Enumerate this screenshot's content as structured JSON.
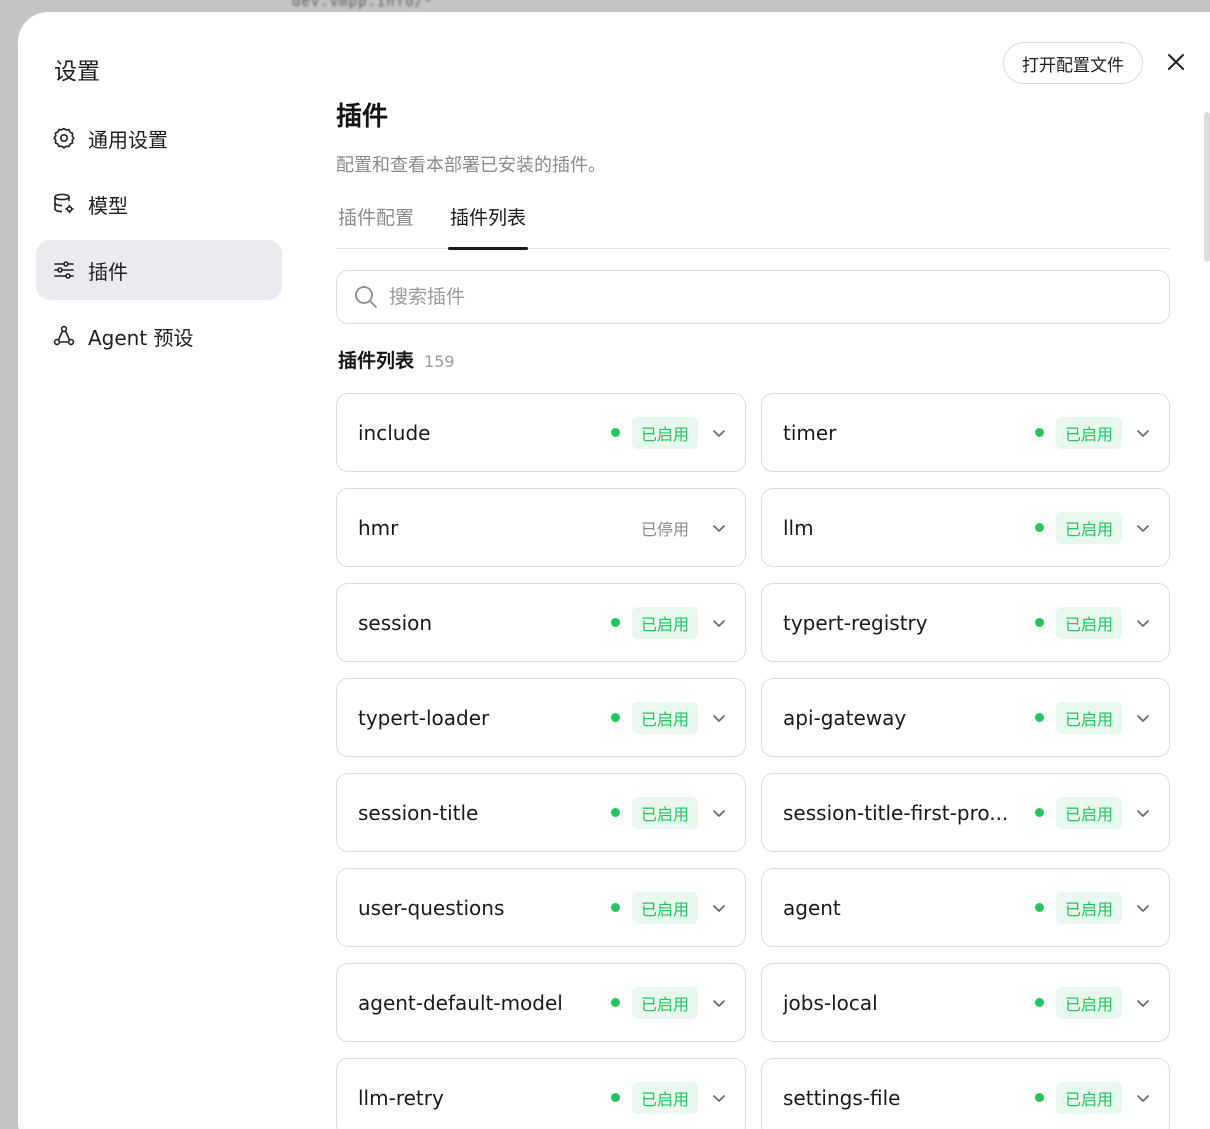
{
  "backdrop": {
    "code_text": "dev.vmpp.info/*"
  },
  "sidebar": {
    "title": "设置",
    "items": [
      {
        "label": "通用设置",
        "icon": "gear-icon",
        "active": false
      },
      {
        "label": "模型",
        "icon": "database-settings-icon",
        "active": false
      },
      {
        "label": "插件",
        "icon": "sliders-icon",
        "active": true
      },
      {
        "label": "Agent 预设",
        "icon": "agent-network-icon",
        "active": false
      }
    ]
  },
  "header": {
    "open_config_label": "打开配置文件",
    "close_icon": "close-icon"
  },
  "main": {
    "title": "插件",
    "description": "配置和查看本部署已安装的插件。",
    "tabs": [
      {
        "label": "插件配置",
        "active": false
      },
      {
        "label": "插件列表",
        "active": true
      }
    ],
    "search": {
      "placeholder": "搜索插件",
      "value": ""
    },
    "list_title": "插件列表",
    "list_count": "159"
  },
  "colors": {
    "enabled": "#22c55e",
    "enabled_bg": "#e8f8ee",
    "active_nav_bg": "#e9ebf0"
  },
  "plugins": [
    {
      "name": "include",
      "status": "已启用",
      "enabled": true
    },
    {
      "name": "timer",
      "status": "已启用",
      "enabled": true
    },
    {
      "name": "hmr",
      "status": "已停用",
      "enabled": false
    },
    {
      "name": "llm",
      "status": "已启用",
      "enabled": true
    },
    {
      "name": "session",
      "status": "已启用",
      "enabled": true
    },
    {
      "name": "typert-registry",
      "status": "已启用",
      "enabled": true
    },
    {
      "name": "typert-loader",
      "status": "已启用",
      "enabled": true
    },
    {
      "name": "api-gateway",
      "status": "已启用",
      "enabled": true
    },
    {
      "name": "session-title",
      "status": "已启用",
      "enabled": true
    },
    {
      "name": "session-title-first-pro...",
      "status": "已启用",
      "enabled": true
    },
    {
      "name": "user-questions",
      "status": "已启用",
      "enabled": true
    },
    {
      "name": "agent",
      "status": "已启用",
      "enabled": true
    },
    {
      "name": "agent-default-model",
      "status": "已启用",
      "enabled": true
    },
    {
      "name": "jobs-local",
      "status": "已启用",
      "enabled": true
    },
    {
      "name": "llm-retry",
      "status": "已启用",
      "enabled": true
    },
    {
      "name": "settings-file",
      "status": "已启用",
      "enabled": true
    }
  ]
}
